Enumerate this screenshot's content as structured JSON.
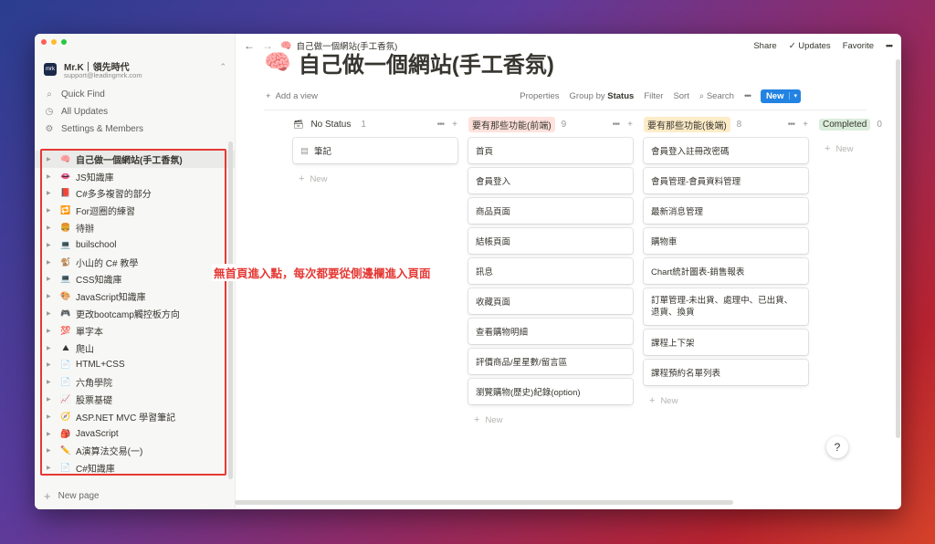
{
  "window": {
    "traffic_colors": [
      "#ff5f57",
      "#febc2e",
      "#28c840"
    ]
  },
  "workspace": {
    "name": "Mr.K｜領先時代",
    "email": "support@leadingmrk.com",
    "logo_text": "mrk",
    "switch_icon": "⌃"
  },
  "sidebar": {
    "nav": [
      {
        "icon": "search-icon",
        "glyph": "⌕",
        "label": "Quick Find"
      },
      {
        "icon": "clock-icon",
        "glyph": "◷",
        "label": "All Updates"
      },
      {
        "icon": "gear-icon",
        "glyph": "⚙",
        "label": "Settings & Members"
      }
    ],
    "tree": [
      {
        "emoji": "🧠",
        "label": "自己做一個網站(手工香氛)",
        "active": true
      },
      {
        "emoji": "👄",
        "label": "JS知識庫"
      },
      {
        "emoji": "📕",
        "label": "C#多多複習的部分"
      },
      {
        "emoji": "🔁",
        "label": "For迴圈的練習"
      },
      {
        "emoji": "🍔",
        "label": "待辦"
      },
      {
        "emoji": "💻",
        "label": "builschool"
      },
      {
        "emoji": "🐒",
        "label": "小山的 C# 教學"
      },
      {
        "emoji": "💻",
        "label": "CSS知識庫"
      },
      {
        "emoji": "🎨",
        "label": "JavaScript知識庫"
      },
      {
        "emoji": "🎮",
        "label": "更改bootcamp觸控板方向"
      },
      {
        "emoji": "💯",
        "label": "單字本"
      },
      {
        "emoji": "⛰",
        "label": "爬山"
      },
      {
        "emoji": "📄",
        "label": "HTML+CSS"
      },
      {
        "emoji": "📄",
        "label": "六角學院"
      },
      {
        "emoji": "📈",
        "label": "股票基礎"
      },
      {
        "emoji": "🧭",
        "label": "ASP.NET MVC 學習筆記"
      },
      {
        "emoji": "🎒",
        "label": "JavaScript"
      },
      {
        "emoji": "✏️",
        "label": "A演算法交易(一)"
      },
      {
        "emoji": "📄",
        "label": "C#知識庫"
      }
    ],
    "new_page": "New page"
  },
  "topbar": {
    "back": "←",
    "forward": "→",
    "breadcrumb_emoji": "🧠",
    "breadcrumb": "自己做一個網站(手工香氛)",
    "share": "Share",
    "updates": "Updates",
    "updates_glyph": "✓",
    "favorite": "Favorite",
    "more": "•••"
  },
  "page": {
    "emoji": "🧠",
    "title": "自己做一個網站(手工香氛)"
  },
  "toolbar": {
    "add_view": "Add a view",
    "properties": "Properties",
    "group_by_prefix": "Group by",
    "group_by_value": "Status",
    "filter": "Filter",
    "sort": "Sort",
    "search": "Search",
    "more": "•••",
    "new": "New",
    "new_caret": "▾"
  },
  "board": {
    "more": "•••",
    "add": "+",
    "new_label": "New",
    "columns": [
      {
        "label": "No Status",
        "count": "1",
        "color": "transparent",
        "icon": "inbox-icon",
        "glyph": "🗃",
        "cards": [
          "筆記"
        ],
        "card_icons": true
      },
      {
        "label": "要有那些功能(前端)",
        "count": "9",
        "color": "#ffe2dd",
        "cards": [
          "首頁",
          "會員登入",
          "商品頁面",
          "結帳頁面",
          "訊息",
          "收藏頁面",
          "查看購物明細",
          "評價商品/星星數/留言區",
          "瀏覽購物(歷史)紀錄(option)"
        ]
      },
      {
        "label": "要有那些功能(後端)",
        "count": "8",
        "color": "#fdecc8",
        "cards": [
          "會員登入註冊改密碼",
          "會員管理-會員資料管理",
          "最新消息管理",
          "購物車",
          "Chart統計圖表-銷售報表",
          "訂單管理-未出貨、處理中、已出貨、退貨、換貨",
          "課程上下架",
          "課程預約名單列表"
        ]
      },
      {
        "label": "Completed",
        "count": "0",
        "color": "#dbeddb",
        "cards": []
      }
    ]
  },
  "annotation": "無首頁進入點，每次都要從側邊欄進入頁面",
  "help": "?"
}
